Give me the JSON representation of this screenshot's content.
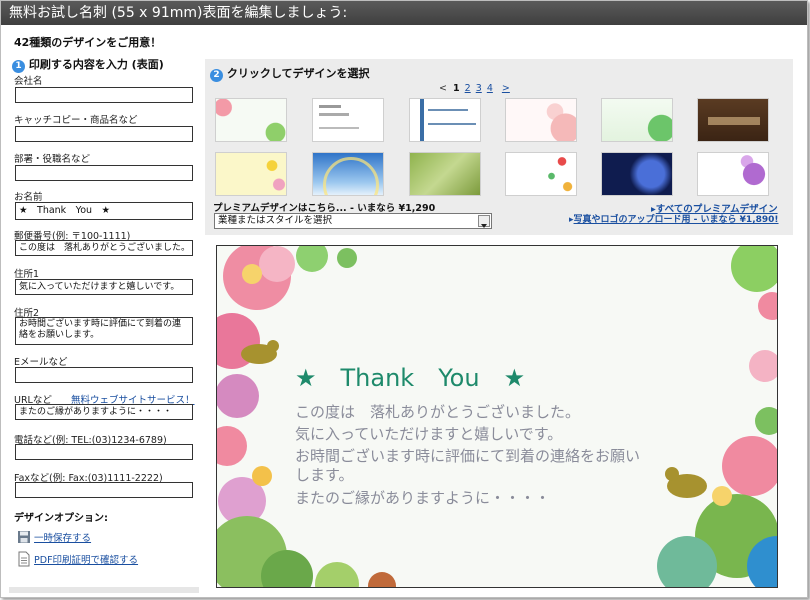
{
  "title": "無料お試し名刺 (55 x 91mm)表面を編集しましょう:",
  "headline": "42種類のデザインをご用意！",
  "left": {
    "step1": "印刷する内容を入力 (表面)",
    "step1_num": "1",
    "fields": [
      {
        "label": "会社名",
        "value": ""
      },
      {
        "label": "キャッチコピー・商品名など",
        "value": ""
      },
      {
        "label": "部署・役職名など",
        "value": ""
      },
      {
        "label": "お名前",
        "value": "★　Thank　You　★"
      },
      {
        "label": "郵便番号(例: 〒100-1111)",
        "value": "この度は　落札ありがとうございました。"
      },
      {
        "label": "住所1",
        "value": "気に入っていただけますと嬉しいです。"
      },
      {
        "label": "住所2",
        "value": "お時間ございます時に評価にて到着の連絡をお願いします。"
      },
      {
        "label": "Eメールなど",
        "value": ""
      },
      {
        "label": "URLなど",
        "value": "またのご縁がありますように・・・・",
        "link": "無料ウェブサイトサービス！"
      },
      {
        "label": "電話など(例: TEL:(03)1234-6789)",
        "value": ""
      },
      {
        "label": "Faxなど(例: Fax:(03)1111-2222)",
        "value": ""
      }
    ],
    "design_options": "デザインオプション:",
    "save": "一時保存する",
    "pdf": "PDF印刷証明で確認する"
  },
  "right": {
    "step2_num": "2",
    "step2": "クリックしてデザインを選択",
    "pager": {
      "prev": "<",
      "pages": [
        "1",
        "2",
        "3",
        "4"
      ],
      "next": ">"
    },
    "premium_text": "プレミアムデザインはこちら... - いまなら ¥1,290",
    "select_value": "業種またはスタイルを選択",
    "link_all": "すべてのプレミアムデザイン",
    "link_upload": "写真やロゴのアップロード用 - いまなら ¥1,890!",
    "thumb_styles": [
      "flower-pink",
      "plain-white",
      "blue-bar",
      "pink-floral",
      "green-leaf",
      "brown-dark",
      "yellow-dots",
      "blue-sky",
      "green-grass",
      "color-dots",
      "navy-swirl",
      "purple-floral"
    ]
  },
  "preview": {
    "title": "★　Thank　You　★",
    "lines": [
      "この度は　落札ありがとうございました。",
      "気に入っていただけますと嬉しいです。",
      "お時間ございます時に評価にて到着の連絡をお願い",
      "します。",
      "またのご縁がありますように・・・・"
    ]
  }
}
